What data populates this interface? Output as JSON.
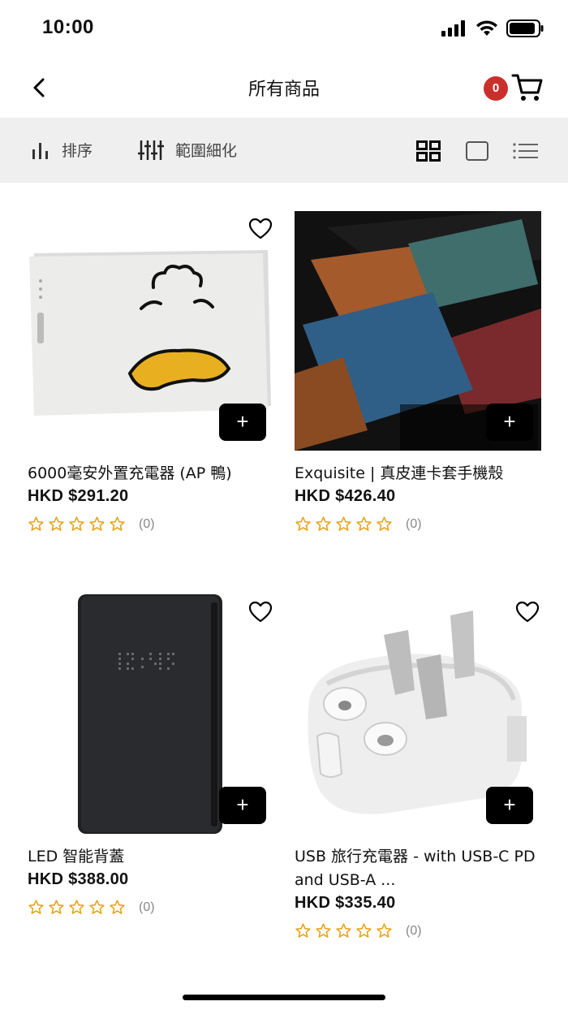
{
  "status": {
    "time": "10:00"
  },
  "header": {
    "title": "所有商品",
    "cart_count": "0"
  },
  "toolbar": {
    "sort_label": "排序",
    "filter_label": "範圍細化"
  },
  "products": [
    {
      "name": "6000毫安外置充電器 (AP 鴨)",
      "price": "HKD $291.20",
      "rating_count": "(0)",
      "add_label": "+"
    },
    {
      "name": "Exquisite | 真皮連卡套手機殼",
      "price": "HKD $426.40",
      "rating_count": "(0)",
      "add_label": "+"
    },
    {
      "name": "LED 智能背蓋",
      "price": "HKD $388.00",
      "rating_count": "(0)",
      "add_label": "+"
    },
    {
      "name": "USB 旅行充電器 - with USB-C PD and USB-A ...",
      "price": "HKD $335.40",
      "rating_count": "(0)",
      "add_label": "+"
    }
  ],
  "colors": {
    "star": "#e8a317",
    "badge": "#c9302c",
    "toolbar_bg": "#efefef"
  }
}
